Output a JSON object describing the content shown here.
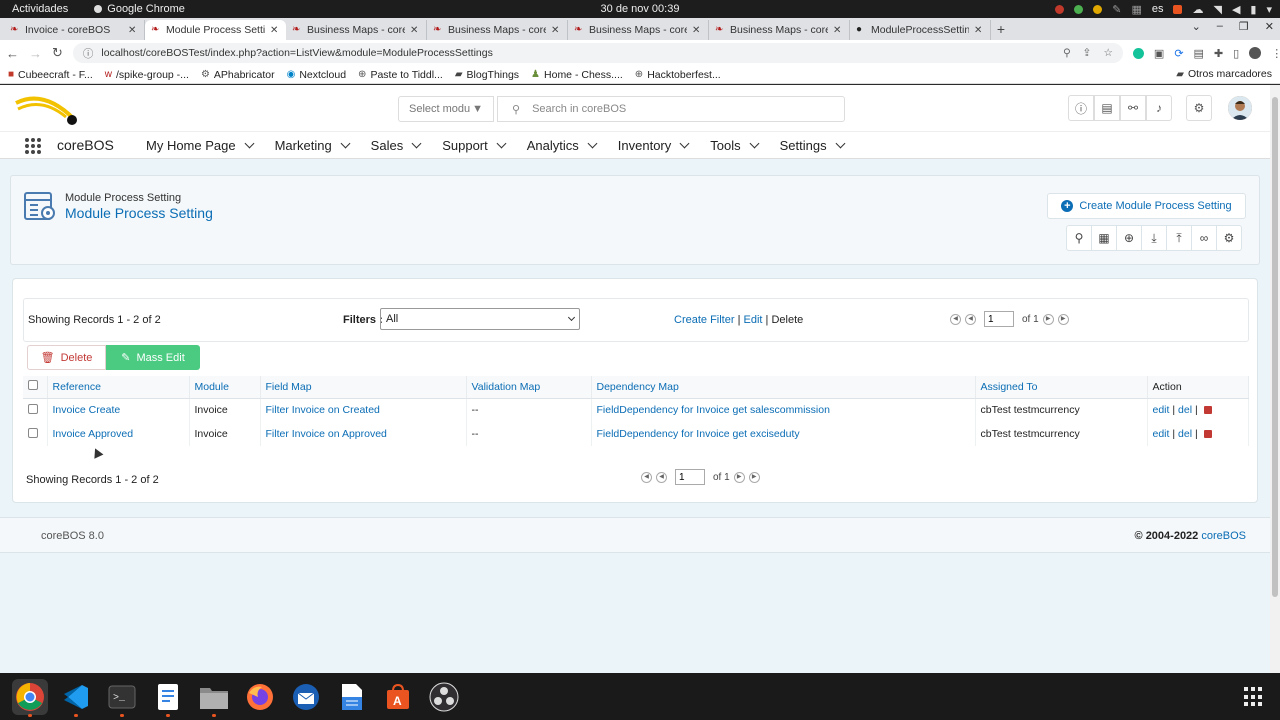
{
  "system": {
    "activities": "Actividades",
    "app_name": "Google Chrome",
    "clock": "30 de nov  00:39",
    "lang": "es"
  },
  "tabs": [
    {
      "label": "Invoice - coreBOS",
      "active": false
    },
    {
      "label": "Module Process Setti",
      "active": true
    },
    {
      "label": "Business Maps - core",
      "active": false
    },
    {
      "label": "Business Maps - core",
      "active": false
    },
    {
      "label": "Business Maps - core",
      "active": false
    },
    {
      "label": "Business Maps - core",
      "active": false
    },
    {
      "label": "ModuleProcessSettin",
      "active": false
    }
  ],
  "address": {
    "url": "localhost/coreBOSTest/index.php?action=ListView&module=ModuleProcessSettings"
  },
  "bookmarks": [
    {
      "label": "Cubeecraft - F..."
    },
    {
      "label": "/spike-group -..."
    },
    {
      "label": "APhabricator"
    },
    {
      "label": "Nextcloud"
    },
    {
      "label": "Paste to Tiddl..."
    },
    {
      "label": "BlogThings"
    },
    {
      "label": "Home - Chess...."
    },
    {
      "label": "Hacktoberfest..."
    }
  ],
  "bookmarks_other": "Otros marcadores",
  "header": {
    "select_module": "Select modu",
    "search_placeholder": "Search in coreBOS"
  },
  "nav": {
    "brand": "coreBOS",
    "items": [
      {
        "label": "My Home Page"
      },
      {
        "label": "Marketing"
      },
      {
        "label": "Sales"
      },
      {
        "label": "Support"
      },
      {
        "label": "Analytics"
      },
      {
        "label": "Inventory"
      },
      {
        "label": "Tools"
      },
      {
        "label": "Settings"
      }
    ]
  },
  "page": {
    "subtitle": "Module Process Setting",
    "title": "Module Process Setting",
    "create_button": "Create Module Process Setting"
  },
  "list": {
    "showing": "Showing Records 1 - 2 of 2",
    "filters_label": "Filters :",
    "filter_value": "All",
    "create_filter": "Create Filter",
    "edit": "Edit",
    "delete": "Delete",
    "sep": "|",
    "page_value": "1",
    "of_pages": "of 1",
    "delete_button": "Delete",
    "mass_edit_button": "Mass Edit",
    "columns": [
      "Reference",
      "Module",
      "Field Map",
      "Validation Map",
      "Dependency Map",
      "Assigned To",
      "Action"
    ],
    "rows": [
      {
        "reference": "Invoice Create",
        "module": "Invoice",
        "field_map": "Filter Invoice on Created",
        "validation_map": "--",
        "dependency_map": "FieldDependency for Invoice get salescommission",
        "assigned_to": "cbTest testmcurrency",
        "act_edit": "edit",
        "act_del": "del"
      },
      {
        "reference": "Invoice Approved",
        "module": "Invoice",
        "field_map": "Filter Invoice on Approved",
        "validation_map": "--",
        "dependency_map": "FieldDependency for Invoice get exciseduty",
        "assigned_to": "cbTest testmcurrency",
        "act_edit": "edit",
        "act_del": "del"
      }
    ]
  },
  "footer": {
    "version": "coreBOS 8.0",
    "copyright": "© 2004-2022",
    "copyright_link": "coreBOS"
  },
  "colors": {
    "link": "#0b6db5",
    "mass_edit": "#4bca81",
    "delete": "#c23934"
  }
}
